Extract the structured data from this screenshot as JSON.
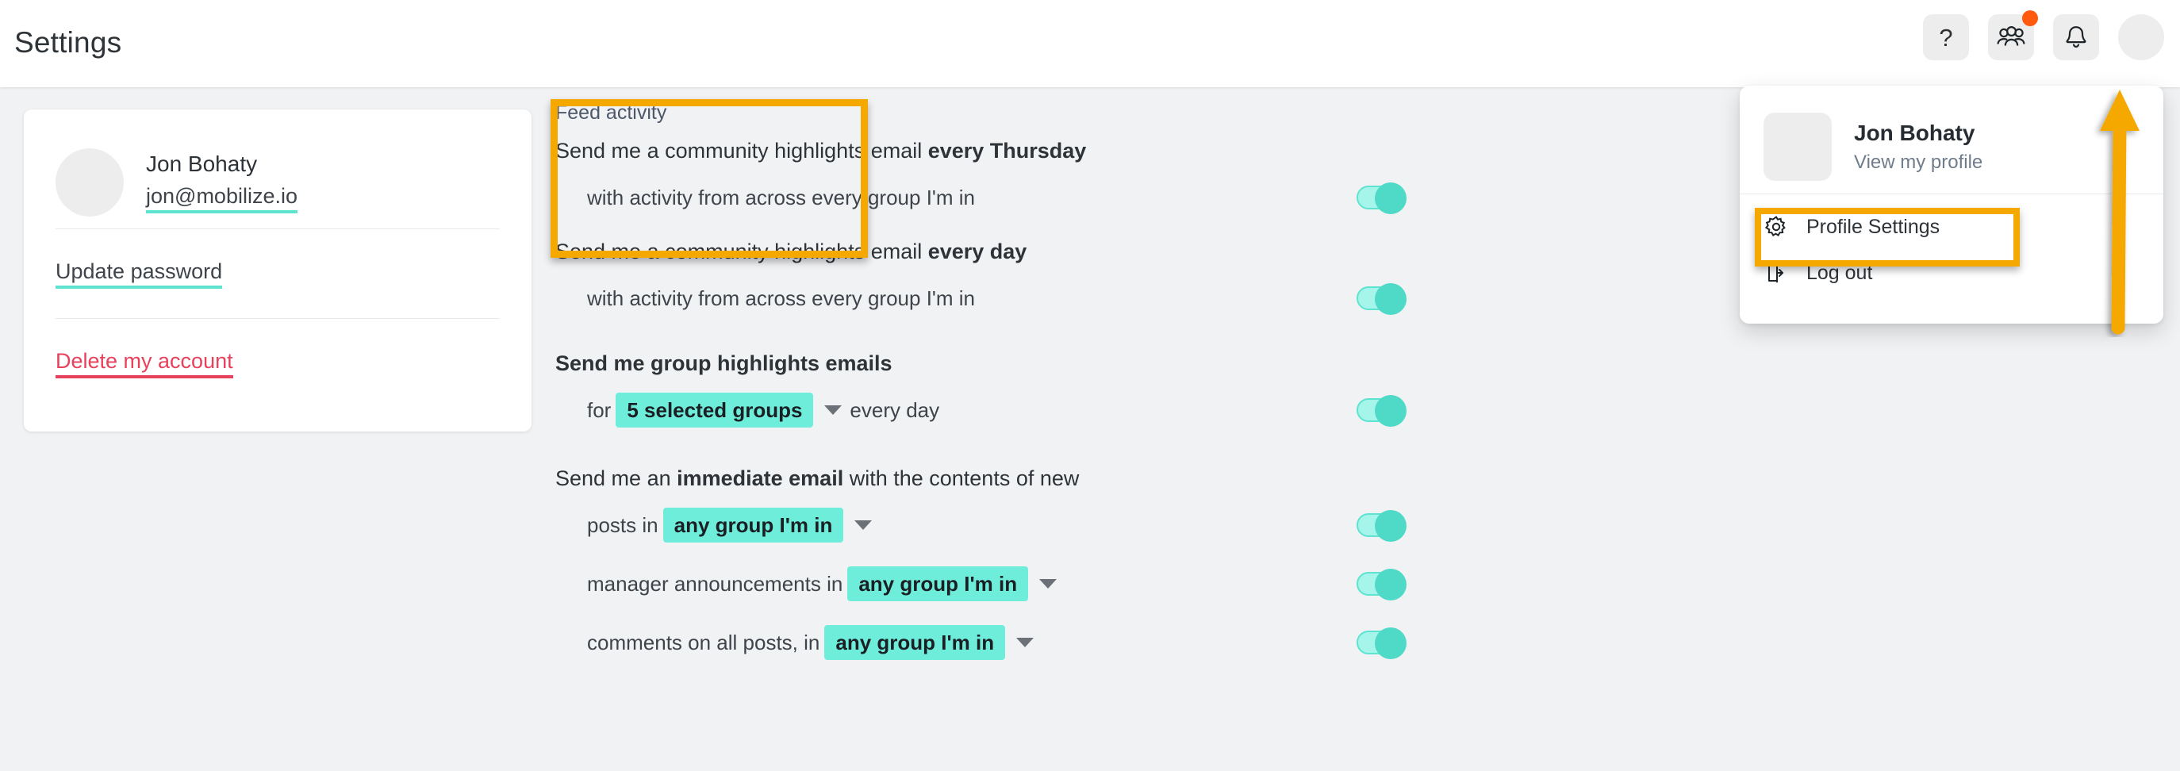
{
  "header": {
    "title": "Settings",
    "actions": [
      {
        "name": "help-button",
        "icon": "question-mark-icon",
        "label": "?"
      },
      {
        "name": "community-button",
        "icon": "people-group-icon",
        "label": "",
        "has_badge": true
      },
      {
        "name": "notifications-button",
        "icon": "bell-icon",
        "label": ""
      },
      {
        "name": "account-avatar-button",
        "icon": "avatar-image",
        "label": ""
      }
    ],
    "badge_color": "#FF5A0E",
    "icon_button_bg": "#EDEDED"
  },
  "profile_menu": {
    "name": "Jon Bohaty",
    "view_profile_link": "View my profile",
    "items": [
      {
        "label": "Profile Settings",
        "icon": "gear-icon",
        "highlighted": true
      },
      {
        "label": "Log out",
        "icon": "logout-icon",
        "highlighted": false
      }
    ]
  },
  "profile_card": {
    "name": "Jon Bohaty",
    "email": "jon@mobilize.io",
    "update_password_label": "Update password",
    "delete_account_label": "Delete my account",
    "link_underline_color": "#5EE3D0",
    "danger_color": "#E8415C"
  },
  "settings": {
    "feed_activity_label": "Feed activity",
    "sections": [
      {
        "id": "community-highlights-thursday",
        "statement_prefix": "Send me a community highlights email ",
        "statement_strong": "every Thursday",
        "rows": [
          {
            "text": "with activity from across every group I'm in",
            "toggle_on": true
          }
        ]
      },
      {
        "id": "community-highlights-daily",
        "statement_prefix": "Send me a community highlights email ",
        "statement_strong": "every day",
        "rows": [
          {
            "text": "with activity from across every group I'm in",
            "toggle_on": true
          }
        ]
      },
      {
        "id": "group-highlights",
        "statement_plain": "Send me group highlights emails",
        "rows": [
          {
            "prefix": "for",
            "chip": "5 selected groups",
            "suffix": "every day",
            "toggle_on": true
          }
        ]
      },
      {
        "id": "immediate-email",
        "statement_prefix_reg": "Send me an ",
        "statement_strong": "immediate email",
        "statement_suffix_reg": " with the contents of new",
        "rows": [
          {
            "prefix": "posts in",
            "chip": "any group I'm in",
            "suffix": "",
            "toggle_on": true
          },
          {
            "prefix": "manager announcements in",
            "chip": "any group I'm in",
            "suffix": "",
            "toggle_on": true
          },
          {
            "prefix": "comments on all posts, in",
            "chip": "any group I'm in",
            "suffix": "",
            "toggle_on": true
          }
        ]
      }
    ],
    "chip_color": "#6FEDDB",
    "toggle_on_track": "#A6F5EA",
    "toggle_on_knob": "#4FD9C7"
  },
  "annotations": {
    "highlight_color": "#F5A800",
    "arrow_color": "#F5A800",
    "highlighted_regions": [
      "feed-activity-section",
      "profile-settings-menu-item"
    ]
  }
}
